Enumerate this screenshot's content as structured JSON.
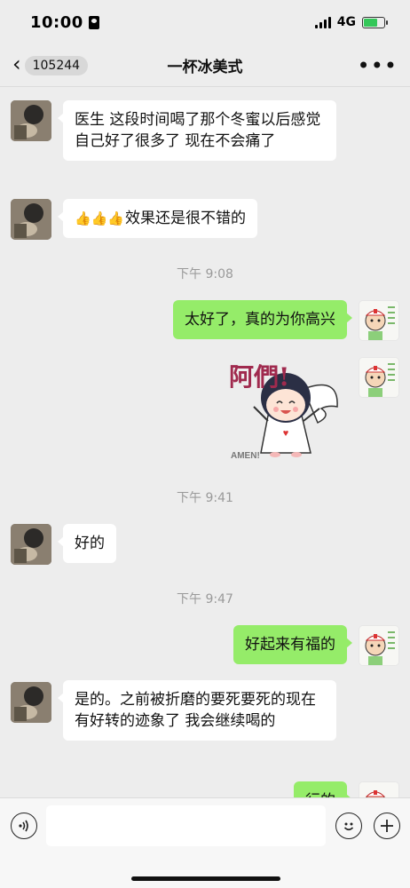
{
  "status_bar": {
    "time": "10:00",
    "network": "4G",
    "icons": [
      "id-card-icon",
      "signal-icon",
      "battery-charging-icon"
    ],
    "battery_level": 0.7
  },
  "nav": {
    "back_icon": "chevron-left-icon",
    "unread_count": "105244",
    "title": "一杯冰美式",
    "more_icon": "more-dots-icon"
  },
  "messages": [
    {
      "side": "left",
      "text": "医生 这段时间喝了那个冬蜜以后感觉自己好了很多了 现在不会痛了"
    },
    {
      "side": "left",
      "emoji": "👍👍👍",
      "text": "效果还是很不错的"
    },
    {
      "type": "time",
      "text": "下午 9:08"
    },
    {
      "side": "right",
      "text": "太好了，真的为你高兴"
    },
    {
      "side": "right",
      "type": "sticker",
      "sticker_text": "阿們!",
      "sticker_caption": "AMEN!"
    },
    {
      "type": "time",
      "text": "下午 9:41"
    },
    {
      "side": "left",
      "text": "好的"
    },
    {
      "type": "time",
      "text": "下午 9:47"
    },
    {
      "side": "right",
      "text": "好起来有福的"
    },
    {
      "side": "left",
      "text": "是的。之前被折磨的要死要死的现在有好转的迹象了 我会继续喝的"
    },
    {
      "side": "right",
      "text": "行的"
    }
  ],
  "input_bar": {
    "voice_icon": "voice-icon",
    "input_value": "",
    "emoji_icon": "emoji-icon",
    "add_icon": "plus-icon"
  },
  "colors": {
    "background": "#ededed",
    "sent_bubble": "#95ec69",
    "received_bubble": "#ffffff",
    "timestamp": "#9a9a9a"
  }
}
